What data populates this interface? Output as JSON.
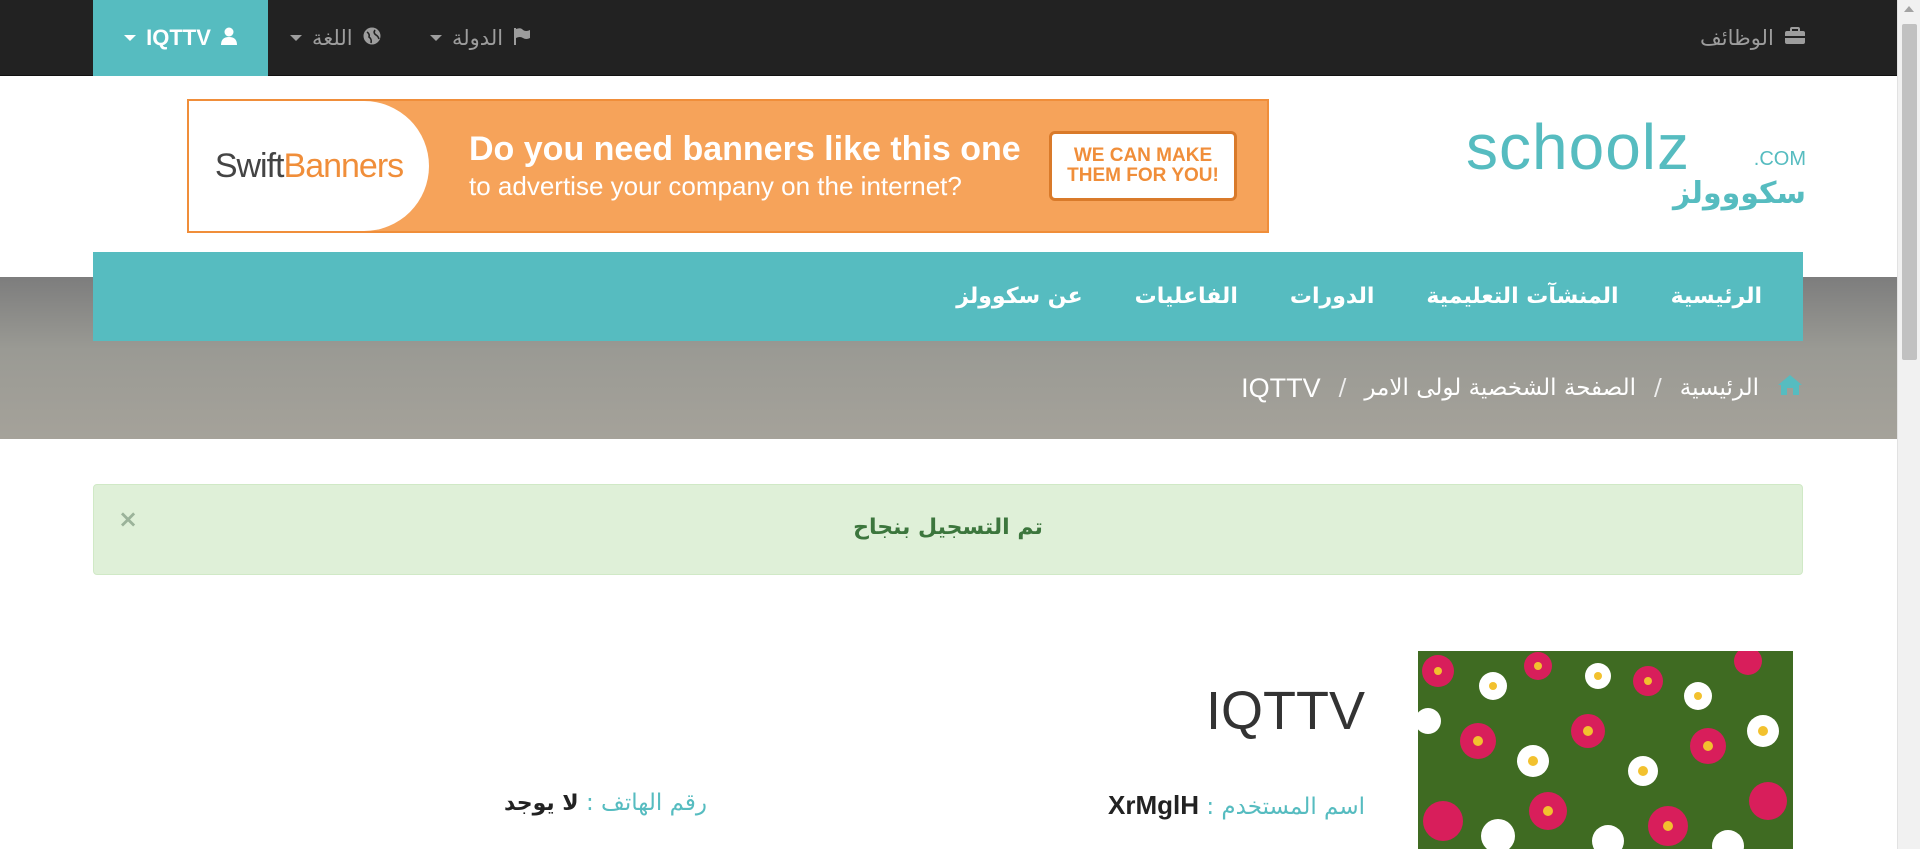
{
  "topbar": {
    "user": "IQTTV",
    "language": "اللغة",
    "country": "الدولة",
    "jobs": "الوظائف"
  },
  "banner": {
    "brand_part1": "Swift",
    "brand_part2": "Banners",
    "line1": "Do you need banners like this one",
    "line2": "to advertise your company on the internet?",
    "cta": "WE CAN MAKE THEM FOR YOU!"
  },
  "logo": {
    "text": "schoolz",
    "com": ".COM",
    "arabic": "سكووولز"
  },
  "nav": {
    "items": [
      "الرئيسية",
      "المنشآت التعليمية",
      "الدورات",
      "الفاعليات",
      "عن سكوولز"
    ]
  },
  "breadcrumb": {
    "home": "الرئيسية",
    "parent": "الصفحة الشخصية لولى الامر",
    "current": "IQTTV"
  },
  "alert": {
    "message": "تم التسجيل بنجاح",
    "close": "×"
  },
  "profile": {
    "name": "IQTTV",
    "username_label": "اسم المستخدم :",
    "username_value": "XrMglH",
    "phone_label": "رقم الهاتف :",
    "phone_value": "لا يوجد"
  },
  "colors": {
    "accent": "#56bcc0",
    "topbar": "#222222",
    "alert_bg": "#dff0d8",
    "alert_text": "#3c763d"
  }
}
